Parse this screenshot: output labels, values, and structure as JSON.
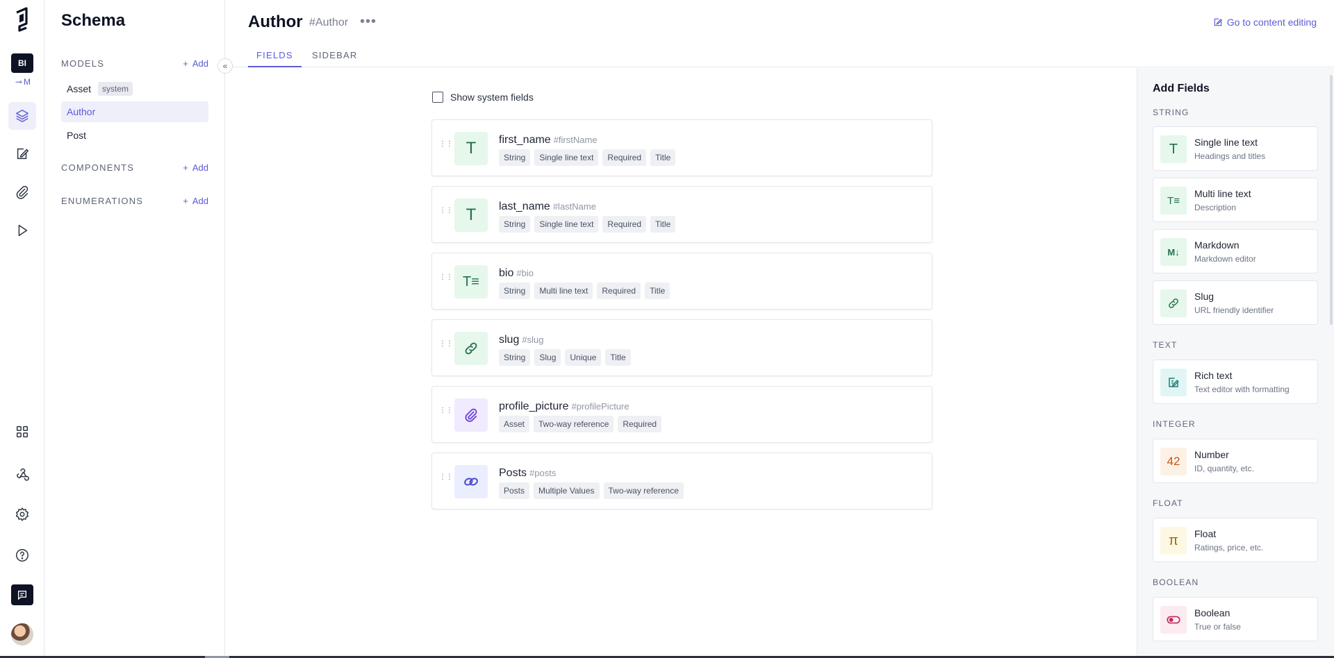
{
  "rail": {
    "project_initials": "BI",
    "environment_label": "M",
    "icons": [
      "logo-icon",
      "schema-icon",
      "content-icon",
      "assets-icon",
      "api-playground-icon",
      "apps-icon",
      "webhooks-icon",
      "settings-icon",
      "help-icon",
      "chat-icon"
    ]
  },
  "schema_sidebar": {
    "title": "Schema",
    "models_label": "MODELS",
    "components_label": "COMPONENTS",
    "enumerations_label": "ENUMERATIONS",
    "add_label": "Add",
    "models": [
      {
        "name": "Asset",
        "badge": "system"
      },
      {
        "name": "Author",
        "badge": ""
      },
      {
        "name": "Post",
        "badge": ""
      }
    ]
  },
  "header": {
    "model_name": "Author",
    "api_id": "#Author",
    "more": "•••",
    "goto_content": "Go to content editing",
    "tabs": [
      "FIELDS",
      "SIDEBAR"
    ]
  },
  "main": {
    "show_system_fields": "Show system fields",
    "fields": [
      {
        "name": "first_name",
        "api": "#firstName",
        "icon": "text-T-icon",
        "tags": [
          "String",
          "Single line text",
          "Required",
          "Title"
        ]
      },
      {
        "name": "last_name",
        "api": "#lastName",
        "icon": "text-T-icon",
        "tags": [
          "String",
          "Single line text",
          "Required",
          "Title"
        ]
      },
      {
        "name": "bio",
        "api": "#bio",
        "icon": "multiline-text-icon",
        "tags": [
          "String",
          "Multi line text",
          "Required",
          "Title"
        ]
      },
      {
        "name": "slug",
        "api": "#slug",
        "icon": "link-icon",
        "tags": [
          "String",
          "Slug",
          "Unique",
          "Title"
        ]
      },
      {
        "name": "profile_picture",
        "api": "#profilePicture",
        "icon": "paperclip-icon",
        "tags": [
          "Asset",
          "Two-way reference",
          "Required"
        ]
      },
      {
        "name": "Posts",
        "api": "#posts",
        "icon": "chain-link-icon",
        "tags": [
          "Posts",
          "Multiple Values",
          "Two-way reference"
        ]
      }
    ]
  },
  "add_fields": {
    "title": "Add Fields",
    "categories": {
      "string": "STRING",
      "text": "TEXT",
      "integer": "INTEGER",
      "float": "FLOAT",
      "boolean": "BOOLEAN"
    },
    "cards": [
      {
        "title": "Single line text",
        "subtitle": "Headings and titles",
        "glyph": "T"
      },
      {
        "title": "Multi line text",
        "subtitle": "Description",
        "glyph": "T≡"
      },
      {
        "title": "Markdown",
        "subtitle": "Markdown editor",
        "glyph": "M↓"
      },
      {
        "title": "Slug",
        "subtitle": "URL friendly identifier",
        "glyph": ""
      },
      {
        "title": "Rich text",
        "subtitle": "Text editor with formatting",
        "glyph": ""
      },
      {
        "title": "Number",
        "subtitle": "ID, quantity, etc.",
        "glyph": "42"
      },
      {
        "title": "Float",
        "subtitle": "Ratings, price, etc.",
        "glyph": "π"
      },
      {
        "title": "Boolean",
        "subtitle": "True or false",
        "glyph": ""
      }
    ]
  }
}
